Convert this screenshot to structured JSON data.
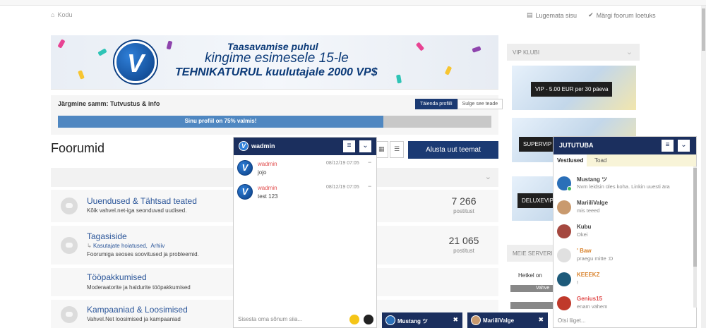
{
  "breadcrumb": {
    "home_label": "Kodu"
  },
  "top_links": {
    "unread": "Lugemata sisu",
    "mark_read": "Märgi foorum loetuks"
  },
  "banner": {
    "logo_letter": "V",
    "line1": "Taasavamise puhul",
    "line2": "kingime esimesele 15-le",
    "line3": "TEHNIKATURUL kuulutajale 2000 VP$"
  },
  "profile_step": {
    "title": "Järgmine samm: Tutvustus & info",
    "complete_button": "Täienda profiili",
    "close_button": "Sulge see teade",
    "progress_text": "Sinu profiil on 75% valmis!",
    "progress_value": 0.75
  },
  "forums": {
    "title": "Foorumid",
    "new_topic": "Alusta uut teemat",
    "rows": [
      {
        "title": "Uuendused & Tähtsad teated",
        "desc": "Kõik vahvel.net-iga seonduvad uudised.",
        "count": "7 266",
        "count_label": "postitust",
        "subs": []
      },
      {
        "title": "Tagasiside",
        "desc": "Foorumiga seoses soovitused ja probleemid.",
        "count": "21 065",
        "count_label": "postitust",
        "subs": [
          "Kasutajate hoiatused,",
          "Arhiiv"
        ]
      },
      {
        "title": "Tööpakkumised",
        "desc": "Moderaatorite ja haldurite tööpakkumised",
        "count": "",
        "count_label": "",
        "subs": []
      },
      {
        "title": "Kampaaniad & Loosimised",
        "desc": "Vahvel.Net loosimised ja kampaaniad",
        "count": "",
        "count_label": "",
        "subs": []
      }
    ]
  },
  "sidebar": {
    "vip_header": "VIP KLUBI",
    "vip_cards": [
      "VIP - 5.00 EUR per 30 päeva",
      "SUPERVIP",
      "DELUXEVIP"
    ],
    "servers_header": "MEIE SERVERI",
    "servers_text": "Hetkel on",
    "server_bar_label": "Vahve"
  },
  "chat": {
    "user": "wadmin",
    "messages": [
      {
        "who": "wadmin",
        "time": "08/12/19 07:05",
        "body": "jojo"
      },
      {
        "who": "wadmin",
        "time": "08/12/19 07:05",
        "body": "test 123"
      }
    ],
    "input_placeholder": "Sisesta oma sõnum siia..."
  },
  "mini_tabs": [
    {
      "name": "Mustang ツ",
      "close": "✖"
    },
    {
      "name": "MariiliValge",
      "close": "✖"
    }
  ],
  "chatroom": {
    "title": "JUTUTUBA",
    "tabs": [
      "Vestlused",
      "Toad"
    ],
    "users": [
      {
        "name": "Mustang ツ",
        "msg": "Nvm leidsin üles koha. Linkin uuesti ära",
        "color": "#444444"
      },
      {
        "name": "MariiliValge",
        "msg": "mis teeed",
        "color": "#444444"
      },
      {
        "name": "Kubu",
        "msg": "Okei",
        "color": "#444444"
      },
      {
        "name": "' Baw",
        "msg": "praegu mitte :D",
        "color": "#d9822b"
      },
      {
        "name": "KEEEKZ",
        "msg": "!",
        "color": "#d9822b"
      },
      {
        "name": "Genius15",
        "msg": "enam vähem",
        "color": "#e04b4b"
      }
    ],
    "input_placeholder": "Otsi liiget..."
  },
  "colors": {
    "navy": "#1b2f5e",
    "accent": "#1b3a73",
    "progress": "#4f87c1",
    "link": "#2a5599"
  }
}
